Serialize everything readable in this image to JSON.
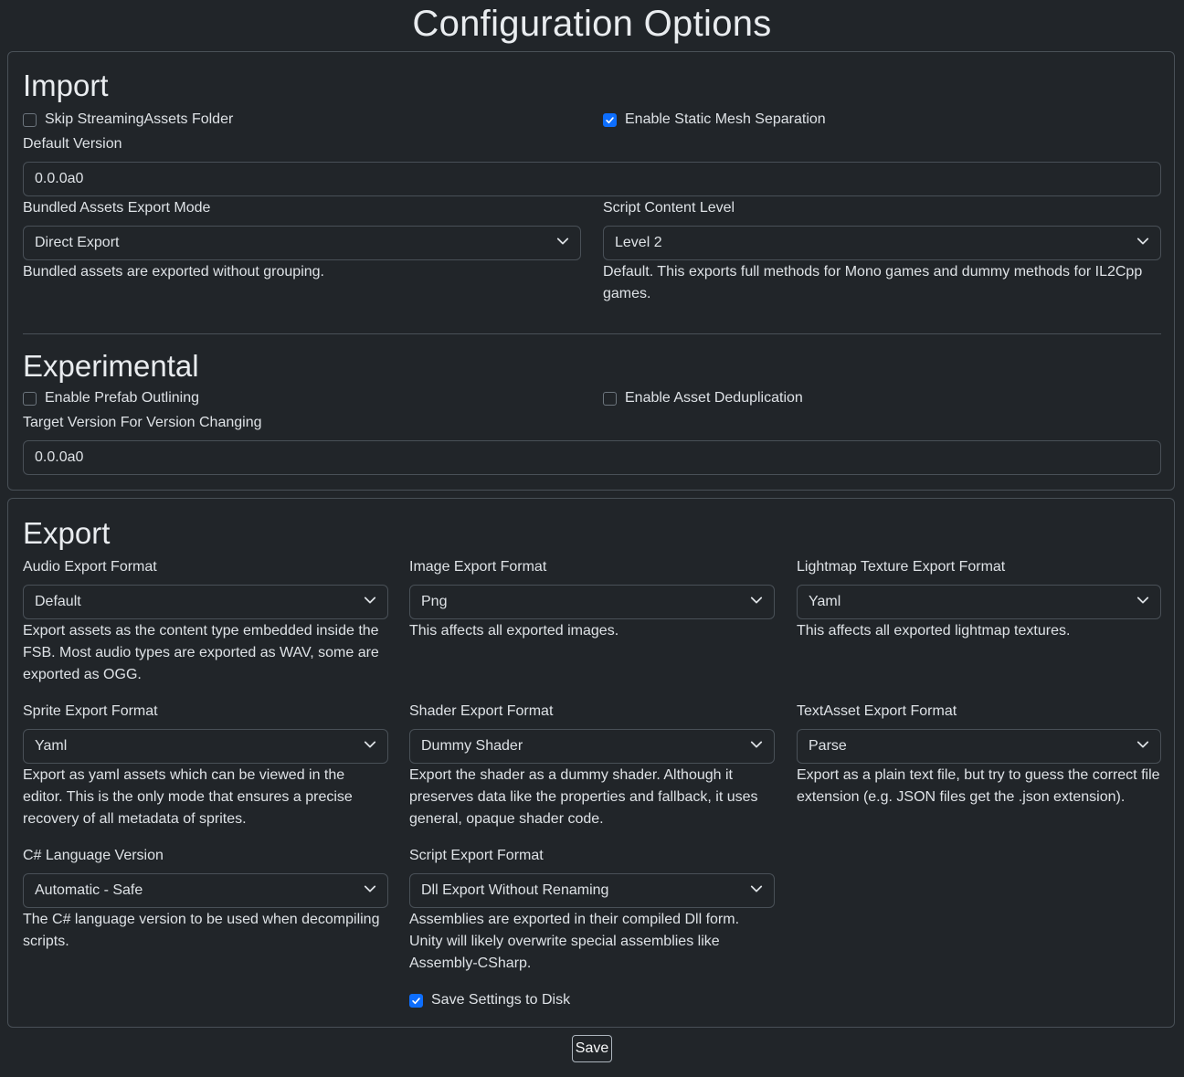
{
  "page": {
    "title": "Configuration Options"
  },
  "import": {
    "title": "Import",
    "skip_streaming": {
      "label": "Skip StreamingAssets Folder",
      "checked": false
    },
    "static_mesh": {
      "label": "Enable Static Mesh Separation",
      "checked": true
    },
    "default_version": {
      "label": "Default Version",
      "value": "0.0.0a0"
    },
    "bundled_mode": {
      "label": "Bundled Assets Export Mode",
      "value": "Direct Export",
      "help": "Bundled assets are exported without grouping."
    },
    "script_level": {
      "label": "Script Content Level",
      "value": "Level 2",
      "help": "Default. This exports full methods for Mono games and dummy methods for IL2Cpp games."
    }
  },
  "experimental": {
    "title": "Experimental",
    "prefab_outlining": {
      "label": "Enable Prefab Outlining",
      "checked": false
    },
    "asset_dedup": {
      "label": "Enable Asset Deduplication",
      "checked": false
    },
    "target_version": {
      "label": "Target Version For Version Changing",
      "value": "0.0.0a0"
    }
  },
  "export": {
    "title": "Export",
    "audio": {
      "label": "Audio Export Format",
      "value": "Default",
      "help": "Export assets as the content type embedded inside the FSB. Most audio types are exported as WAV, some are exported as OGG."
    },
    "image": {
      "label": "Image Export Format",
      "value": "Png",
      "help": "This affects all exported images."
    },
    "lightmap": {
      "label": "Lightmap Texture Export Format",
      "value": "Yaml",
      "help": "This affects all exported lightmap textures."
    },
    "sprite": {
      "label": "Sprite Export Format",
      "value": "Yaml",
      "help": "Export as yaml assets which can be viewed in the editor. This is the only mode that ensures a precise recovery of all metadata of sprites."
    },
    "shader": {
      "label": "Shader Export Format",
      "value": "Dummy Shader",
      "help": "Export the shader as a dummy shader. Although it preserves data like the properties and fallback, it uses general, opaque shader code."
    },
    "textasset": {
      "label": "TextAsset Export Format",
      "value": "Parse",
      "help": "Export as a plain text file, but try to guess the correct file extension (e.g. JSON files get the .json extension)."
    },
    "csharp": {
      "label": "C# Language Version",
      "value": "Automatic - Safe",
      "help": "The C# language version to be used when decompiling scripts."
    },
    "script": {
      "label": "Script Export Format",
      "value": "Dll Export Without Renaming",
      "help": "Assemblies are exported in their compiled Dll form. Unity will likely overwrite special assemblies like Assembly-CSharp."
    },
    "save_settings": {
      "label": "Save Settings to Disk",
      "checked": true
    }
  },
  "actions": {
    "save_label": "Save"
  },
  "colors": {
    "background": "#212529",
    "border": "#495057",
    "accent": "#0d6efd",
    "text": "#dee2e6"
  },
  "icons": {
    "chevron": "chevron-down-icon",
    "check": "checkmark-icon"
  }
}
